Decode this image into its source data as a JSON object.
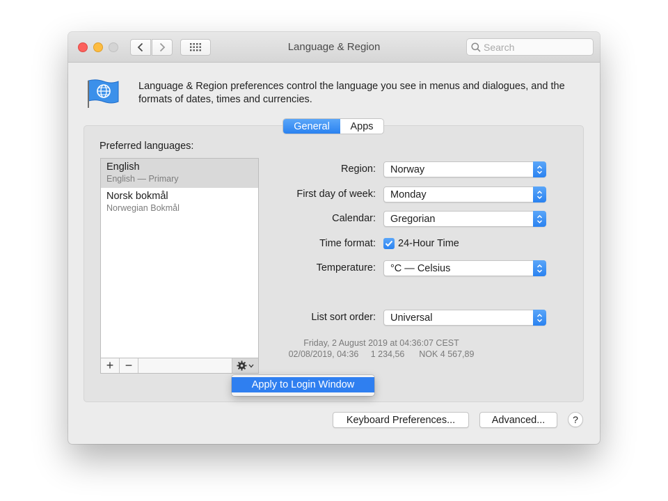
{
  "window": {
    "title": "Language & Region",
    "search_placeholder": "Search"
  },
  "description": "Language & Region preferences control the language you see in menus and dialogues, and the formats of dates, times and currencies.",
  "tabs": [
    {
      "label": "General",
      "selected": true
    },
    {
      "label": "Apps",
      "selected": false
    }
  ],
  "preferred_languages": {
    "label": "Preferred languages:",
    "items": [
      {
        "name": "English",
        "detail": "English — Primary",
        "selected": true
      },
      {
        "name": "Norsk bokmål",
        "detail": "Norwegian Bokmål",
        "selected": false
      }
    ],
    "add_label": "+",
    "remove_label": "−"
  },
  "context_menu": {
    "item": "Apply to Login Window"
  },
  "settings": {
    "region_label": "Region:",
    "region_value": "Norway",
    "first_day_label": "First day of week:",
    "first_day_value": "Monday",
    "calendar_label": "Calendar:",
    "calendar_value": "Gregorian",
    "time_format_label": "Time format:",
    "time_format_checkbox": "24-Hour Time",
    "time_format_checked": true,
    "temperature_label": "Temperature:",
    "temperature_value": "°C — Celsius",
    "sort_label": "List sort order:",
    "sort_value": "Universal"
  },
  "sample": {
    "line1": "Friday, 2 August 2019 at 04:36:07 CEST",
    "line2": "02/08/2019, 04:36     1 234,56      NOK 4 567,89"
  },
  "buttons": {
    "keyboard": "Keyboard Preferences...",
    "advanced": "Advanced...",
    "help": "?"
  },
  "colors": {
    "accent": "#2a82f0",
    "close": "#fc605c",
    "minimize": "#fdbc40",
    "maximize_disabled": "#d4d4d4"
  }
}
